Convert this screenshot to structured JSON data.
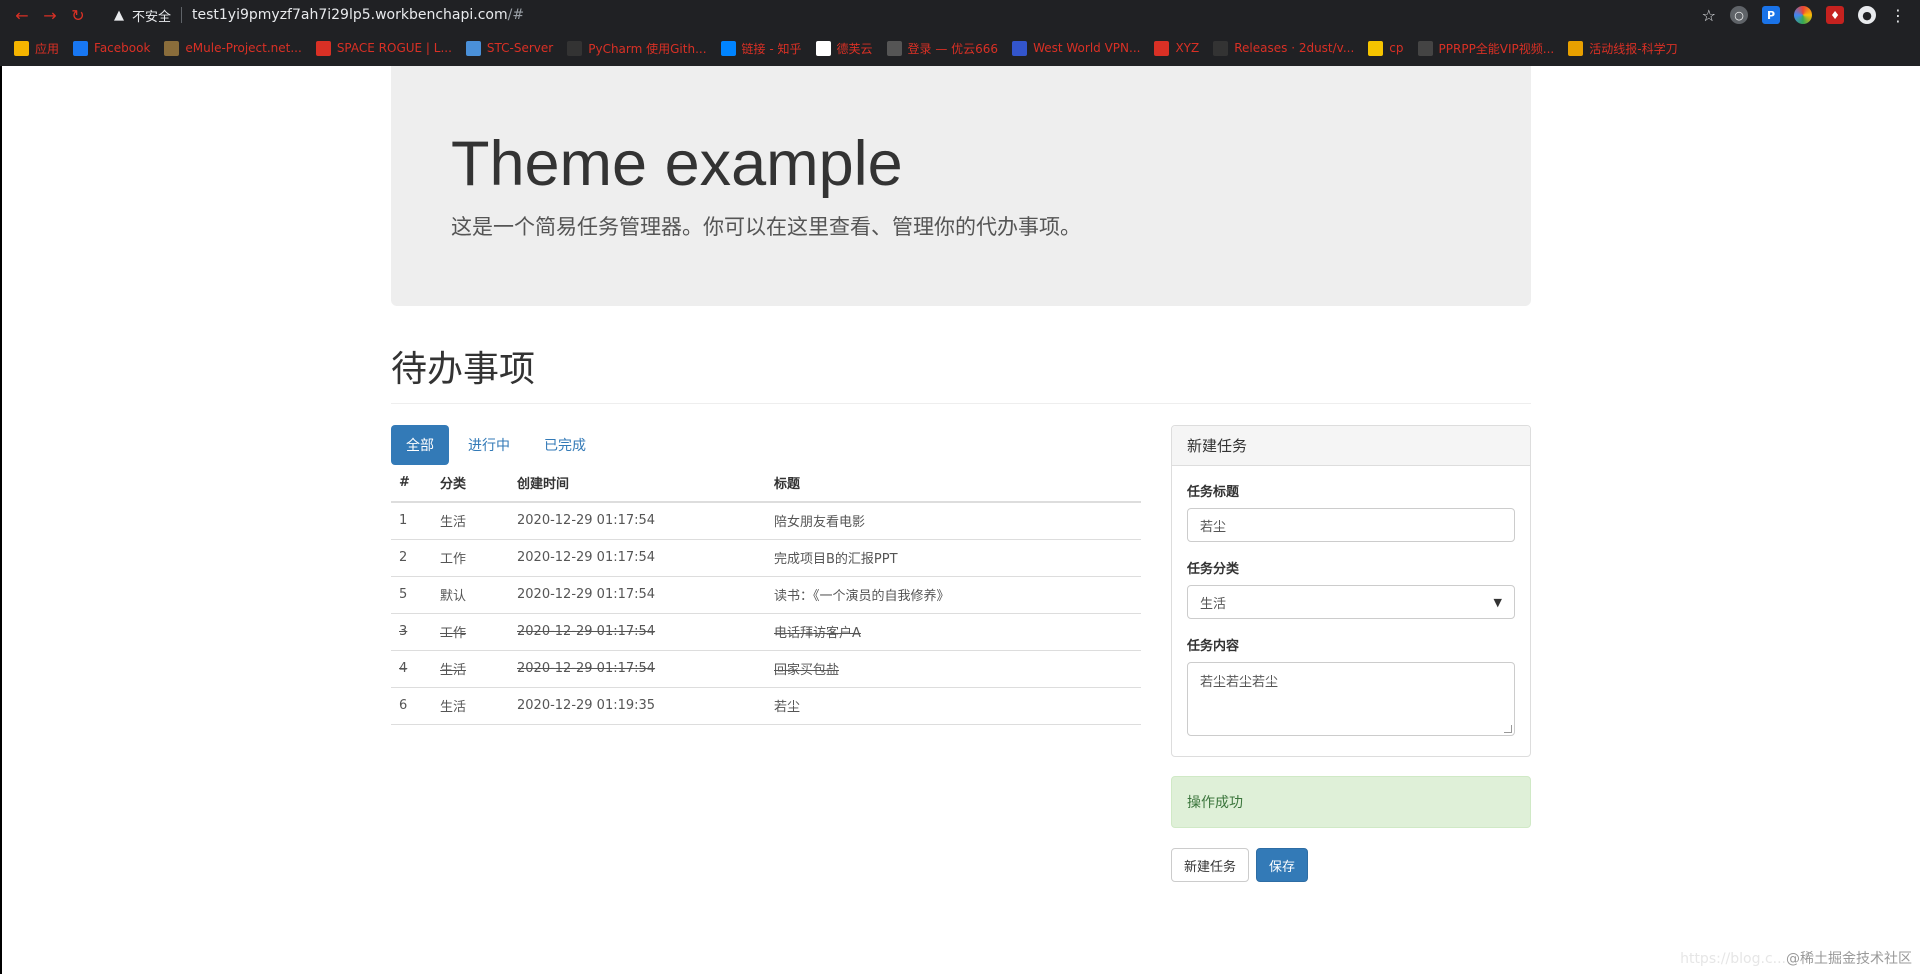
{
  "browser": {
    "insecure_label": "不安全",
    "url_host": "test1yi9pmyzf7ah7i29lp5.workbenchapi.com",
    "url_path": "/#",
    "bookmarks": [
      {
        "label": "应用",
        "icon": "apps-grid-icon",
        "color": "#f5b400"
      },
      {
        "label": "Facebook",
        "icon": "facebook-icon",
        "color": "#1877f2"
      },
      {
        "label": "eMule-Project.net...",
        "icon": "emule-icon",
        "color": "#8a6d3b"
      },
      {
        "label": "SPACE ROGUE | L...",
        "icon": "space-rogue-icon",
        "color": "#d93025"
      },
      {
        "label": "STC-Server",
        "icon": "stc-icon",
        "color": "#4a90d9"
      },
      {
        "label": "PyCharm 使用Gith...",
        "icon": "github-icon",
        "color": "#333333"
      },
      {
        "label": "链接 - 知乎",
        "icon": "zhihu-icon",
        "color": "#0084ff"
      },
      {
        "label": "德芙云",
        "icon": "dove-icon",
        "color": "#ffffff"
      },
      {
        "label": "登录 — 优云666",
        "icon": "youyun-icon",
        "color": "#555555"
      },
      {
        "label": "West World VPN...",
        "icon": "westworld-icon",
        "color": "#3355cc"
      },
      {
        "label": "XYZ",
        "icon": "xyz-icon",
        "color": "#d93025"
      },
      {
        "label": "Releases · 2dust/v...",
        "icon": "github-icon",
        "color": "#333333"
      },
      {
        "label": "cp",
        "icon": "folder-icon",
        "color": "#f5c400"
      },
      {
        "label": "PPRPP全能VIP视频...",
        "icon": "pprpp-icon",
        "color": "#444444"
      },
      {
        "label": "活动线报-科学刀",
        "icon": "kexuedao-icon",
        "color": "#e8a000"
      }
    ]
  },
  "jumbotron": {
    "title": "Theme example",
    "lead": "这是一个简易任务管理器。你可以在这里查看、管理你的代办事项。"
  },
  "section": {
    "title": "待办事项"
  },
  "tabs": [
    {
      "label": "全部",
      "active": true
    },
    {
      "label": "进行中",
      "active": false
    },
    {
      "label": "已完成",
      "active": false
    }
  ],
  "table": {
    "headers": [
      "#",
      "分类",
      "创建时间",
      "标题"
    ],
    "rows": [
      {
        "id": "1",
        "category": "生活",
        "created": "2020-12-29 01:17:54",
        "title": "陪女朋友看电影",
        "done": false
      },
      {
        "id": "2",
        "category": "工作",
        "created": "2020-12-29 01:17:54",
        "title": "完成项目B的汇报PPT",
        "done": false
      },
      {
        "id": "5",
        "category": "默认",
        "created": "2020-12-29 01:17:54",
        "title": "读书：《一个演员的自我修养》",
        "done": false
      },
      {
        "id": "3",
        "category": "工作",
        "created": "2020-12-29 01:17:54",
        "title": "电话拜访客户A",
        "done": true
      },
      {
        "id": "4",
        "category": "生活",
        "created": "2020-12-29 01:17:54",
        "title": "回家买包盐",
        "done": true
      },
      {
        "id": "6",
        "category": "生活",
        "created": "2020-12-29 01:19:35",
        "title": "若尘",
        "done": false
      }
    ]
  },
  "form": {
    "heading": "新建任务",
    "title_label": "任务标题",
    "title_value": "若尘",
    "category_label": "任务分类",
    "category_value": "生活",
    "content_label": "任务内容",
    "content_value": "若尘若尘若尘"
  },
  "alert": {
    "text": "操作成功"
  },
  "buttons": {
    "new_task": "新建任务",
    "save": "保存"
  },
  "watermark": {
    "faint": "https://blog.c...",
    "text": "@稀土掘金技术社区"
  }
}
